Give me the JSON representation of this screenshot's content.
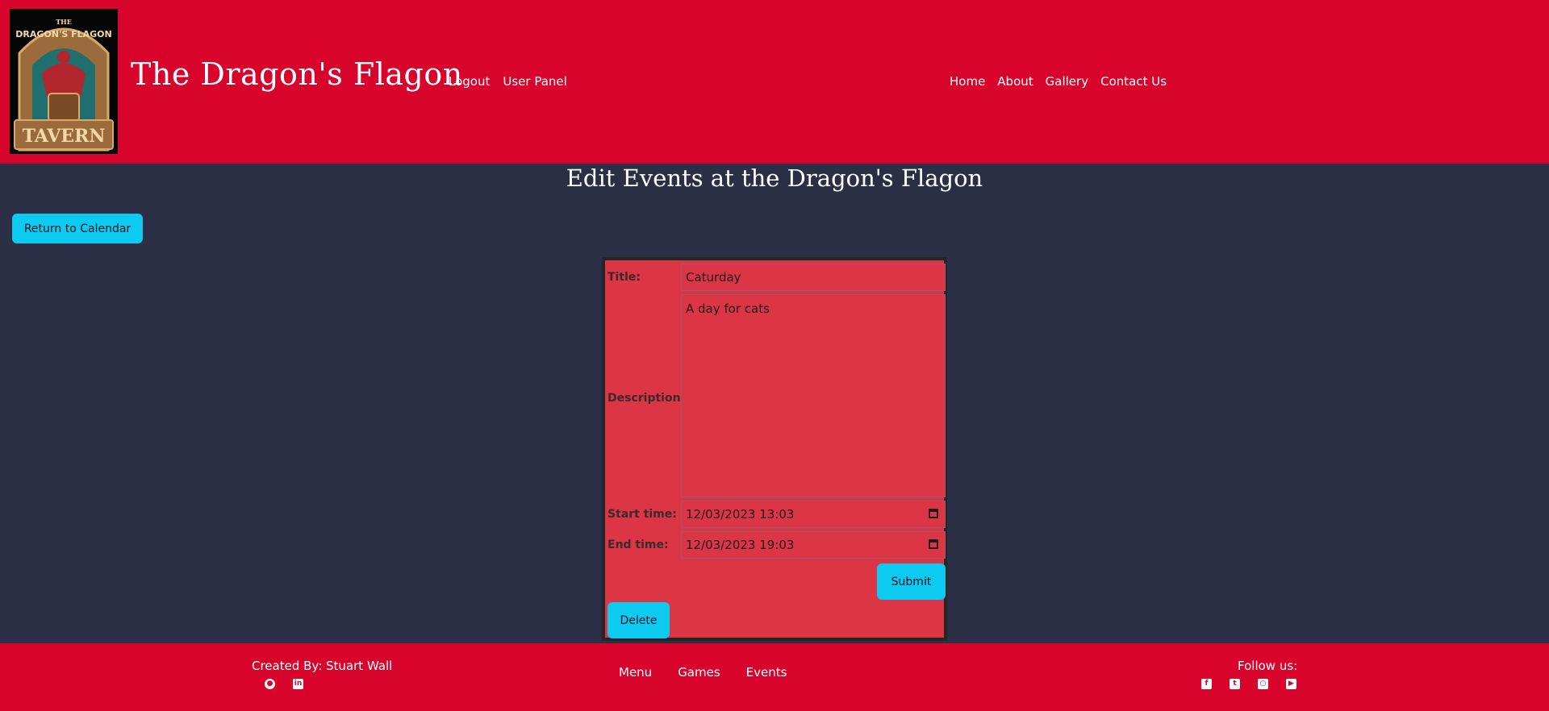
{
  "header": {
    "site_title": "The Dragon's Flagon",
    "logo": {
      "line1": "THE",
      "line2": "DRAGON'S FLAGON",
      "line3": "TAVERN"
    },
    "nav_left": [
      "Logout",
      "User Panel"
    ],
    "nav_right": [
      "Home",
      "About",
      "Gallery",
      "Contact Us"
    ]
  },
  "main": {
    "heading": "Edit Events at the Dragon's Flagon",
    "return_button": "Return to Calendar",
    "form": {
      "title_label": "Title:",
      "title_value": "Caturday",
      "description_label": "Description:",
      "description_value": "A day for cats",
      "start_label": "Start time:",
      "start_value": "12/03/2023 13:03",
      "end_label": "End time:",
      "end_value": "12/03/2023 19:03",
      "submit_label": "Submit",
      "delete_label": "Delete"
    }
  },
  "footer": {
    "credit": "Created By: Stuart Wall",
    "links": [
      "Menu",
      "Games",
      "Events"
    ],
    "follow": "Follow us:",
    "credit_icons": [
      "github-icon",
      "linkedin-icon"
    ],
    "social_icons": [
      "facebook-icon",
      "twitter-icon",
      "instagram-icon",
      "youtube-icon"
    ]
  },
  "colors": {
    "header_bg": "#d9042b",
    "page_bg": "#2b2f45",
    "form_bg": "#dc3545",
    "button_bg": "#0dcaf0"
  }
}
